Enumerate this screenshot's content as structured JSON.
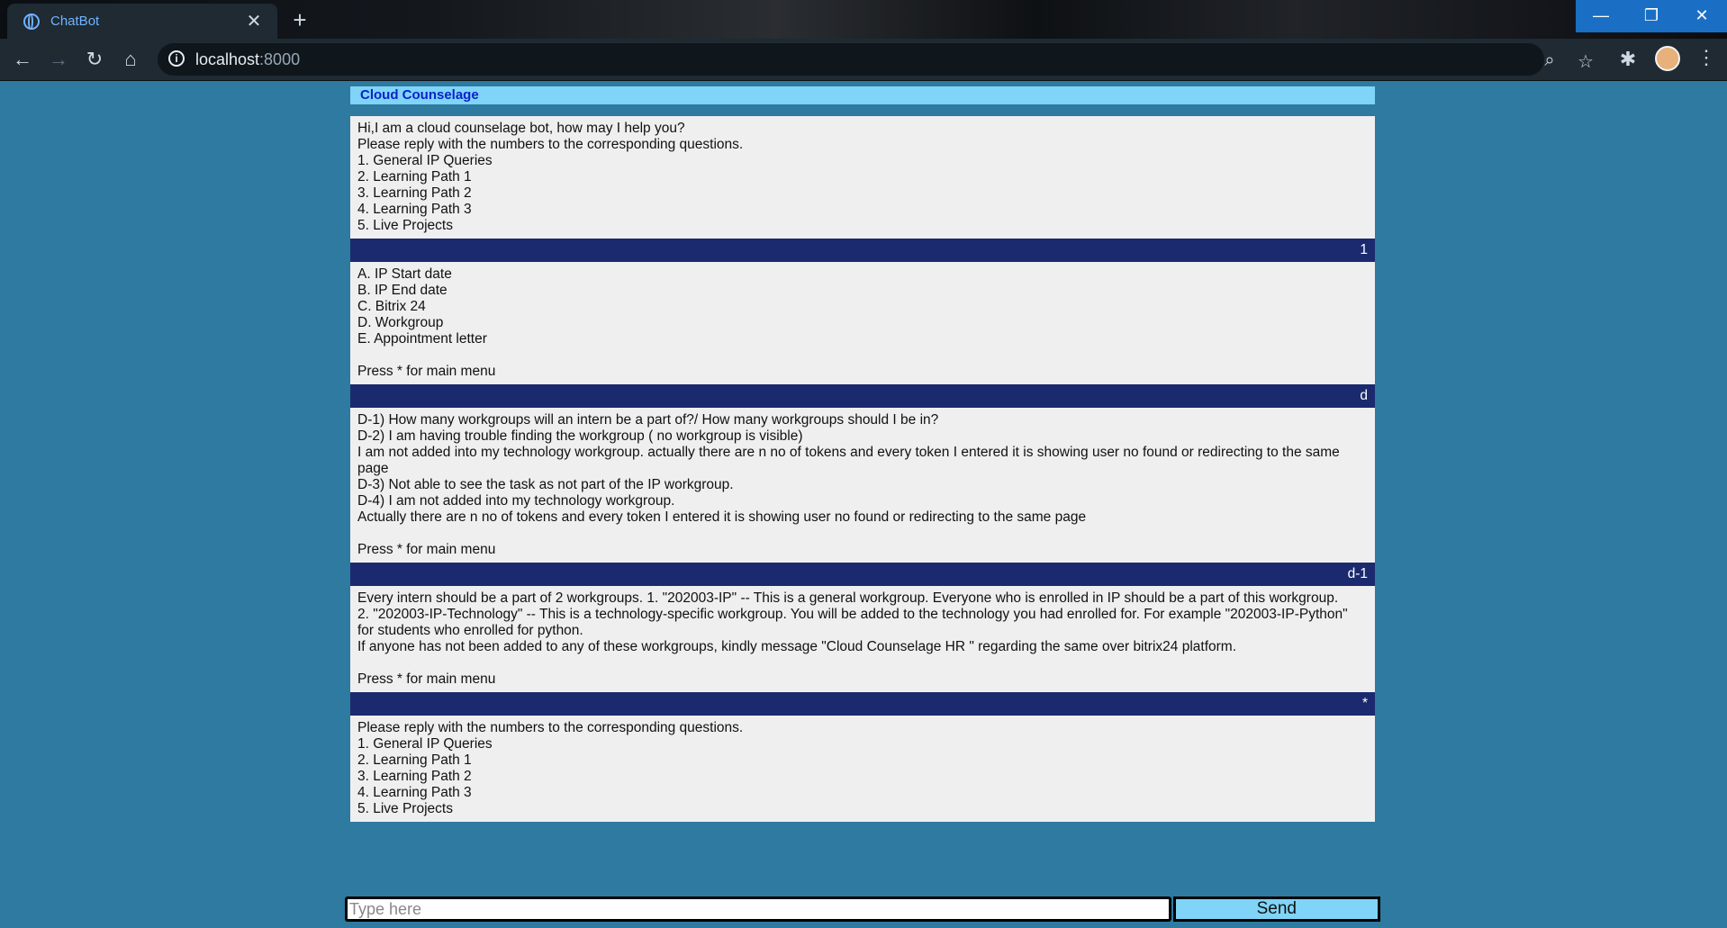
{
  "browser": {
    "tab_title": "ChatBot",
    "tab_close": "✕",
    "new_tab": "+",
    "url_host": "localhost",
    "url_port": ":8000"
  },
  "chat": {
    "title": "Cloud Counselage",
    "messages": [
      {
        "role": "bot",
        "text": "Hi,I am a cloud counselage bot, how may I help you?\nPlease reply with the numbers to the corresponding questions.\n1. General IP Queries\n2. Learning Path 1\n3. Learning Path 2\n4. Learning Path 3\n5. Live Projects"
      },
      {
        "role": "user",
        "text": "1"
      },
      {
        "role": "bot",
        "text": "A. IP Start date\nB. IP End date\nC. Bitrix 24\nD. Workgroup\nE. Appointment letter\n\nPress * for main menu"
      },
      {
        "role": "user",
        "text": "d"
      },
      {
        "role": "bot",
        "text": "D-1) How many workgroups will an intern be a part of?/ How many workgroups should I be in?\nD-2) I am having trouble finding the workgroup ( no workgroup is visible)\nI am not added into my technology workgroup. actually there are n no of tokens and every token I entered it is showing user no found or redirecting to the same page\nD-3) Not able to see the task as not part of the IP workgroup.\nD-4) I am not added into my technology workgroup.\nActually there are n no of tokens and every token I entered it is showing user no found or redirecting to the same page\n\nPress * for main menu"
      },
      {
        "role": "user",
        "text": "d-1"
      },
      {
        "role": "bot",
        "text": "Every intern should be a part of 2 workgroups. 1. \"202003-IP\" -- This is a general workgroup. Everyone who is enrolled in IP should be a part of this workgroup.\n2. \"202003-IP-Technology\" -- This is a technology-specific workgroup. You will be added to the technology you had enrolled for. For example \"202003-IP-Python\" for students who enrolled for python.\nIf anyone has not been added to any of these workgroups, kindly message \"Cloud Counselage HR \" regarding the same over bitrix24 platform.\n\nPress * for main menu"
      },
      {
        "role": "user",
        "text": "*"
      },
      {
        "role": "bot",
        "text": "Please reply with the numbers to the corresponding questions.\n1. General IP Queries\n2. Learning Path 1\n3. Learning Path 2\n4. Learning Path 3\n5. Live Projects"
      }
    ]
  },
  "composer": {
    "placeholder": "Type here",
    "value": "",
    "send_label": "Send"
  }
}
